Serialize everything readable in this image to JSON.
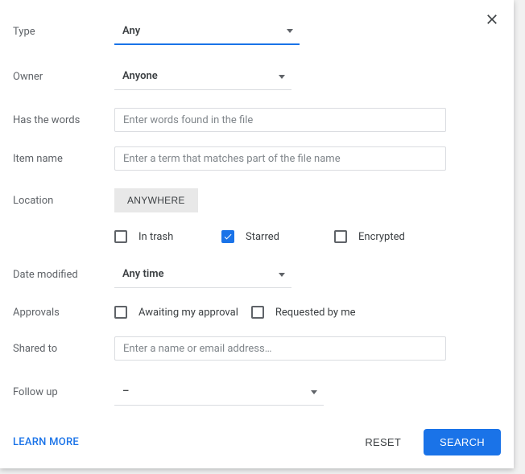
{
  "labels": {
    "type": "Type",
    "owner": "Owner",
    "has_words": "Has the words",
    "item_name": "Item name",
    "location": "Location",
    "date_modified": "Date modified",
    "approvals": "Approvals",
    "shared_to": "Shared to",
    "follow_up": "Follow up"
  },
  "values": {
    "type": "Any",
    "owner": "Anyone",
    "location_chip": "ANYWHERE",
    "date_modified": "Any time",
    "follow_up": "–"
  },
  "placeholders": {
    "has_words": "Enter words found in the file",
    "item_name": "Enter a term that matches part of the file name",
    "shared_to": "Enter a name or email address…"
  },
  "checkboxes": {
    "in_trash": {
      "label": "In trash",
      "checked": false
    },
    "starred": {
      "label": "Starred",
      "checked": true
    },
    "encrypted": {
      "label": "Encrypted",
      "checked": false
    },
    "awaiting": {
      "label": "Awaiting my approval",
      "checked": false
    },
    "requested": {
      "label": "Requested by me",
      "checked": false
    }
  },
  "footer": {
    "learn_more": "LEARN MORE",
    "reset": "RESET",
    "search": "SEARCH"
  }
}
